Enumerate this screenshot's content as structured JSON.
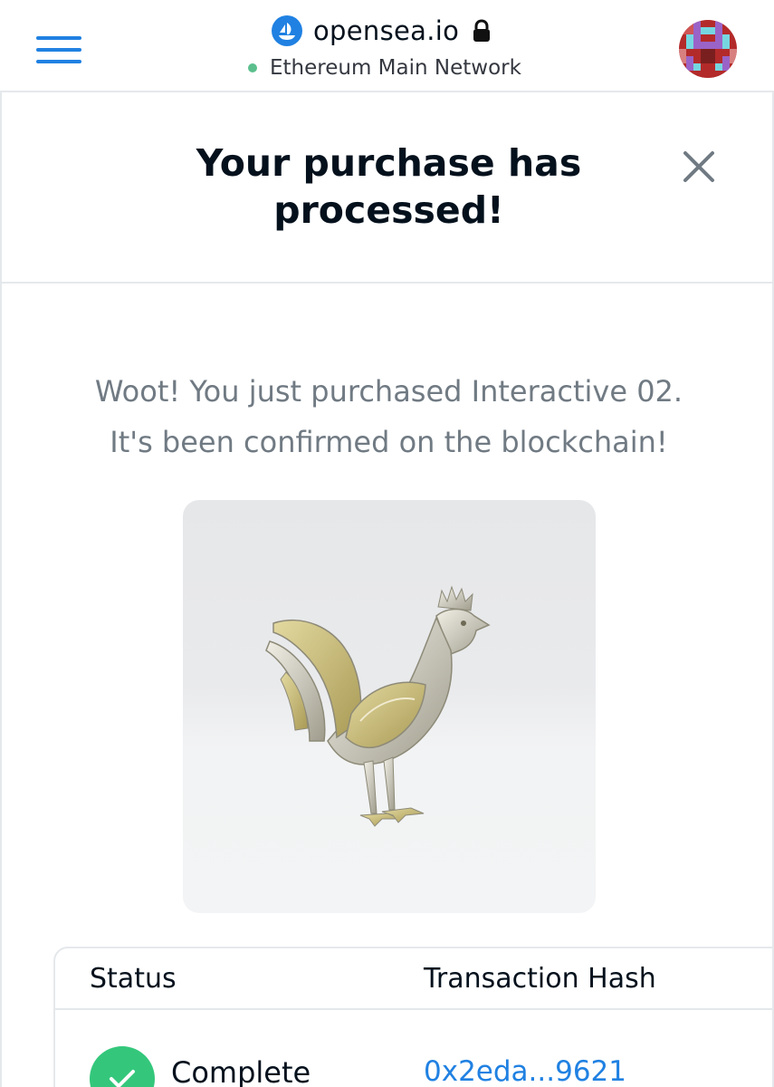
{
  "browser": {
    "domain": "opensea.io",
    "network_label": "Ethereum Main Network",
    "icons": {
      "menu": "hamburger-menu-icon",
      "site": "opensea-logo-icon",
      "secure": "lock-icon",
      "account": "avatar"
    },
    "colors": {
      "accent": "#2081e2",
      "network_dot": "#5bbf8d"
    }
  },
  "modal": {
    "title": "Your purchase has processed!",
    "close_icon": "close-icon",
    "message_line1": "Woot! You just purchased Interactive 02.",
    "message_line2": "It's been confirmed on the blockchain!",
    "nft_image": "rooster-image"
  },
  "transaction": {
    "headers": {
      "status": "Status",
      "hash": "Transaction Hash"
    },
    "status_value": "Complete",
    "status_icon": "check-icon",
    "hash_value": "0x2eda...9621",
    "colors": {
      "complete": "#34c77b",
      "link": "#2081e2"
    }
  }
}
